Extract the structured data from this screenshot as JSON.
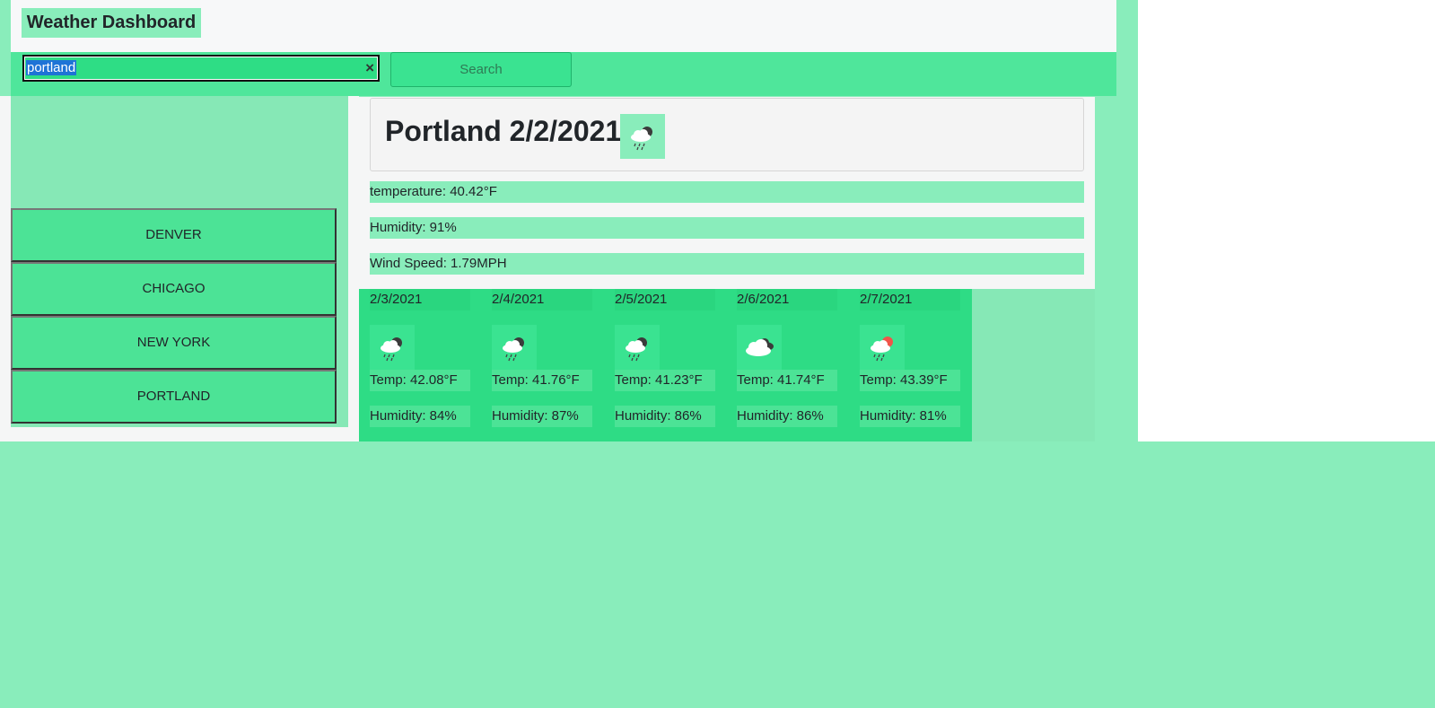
{
  "header": {
    "title": "Weather Dashboard"
  },
  "search": {
    "value": "portland",
    "clear_glyph": "×",
    "button_label": "Search"
  },
  "history": [
    "DENVER",
    "CHICAGO",
    "NEW YORK",
    "PORTLAND"
  ],
  "current": {
    "heading": "Portland 2/2/2021",
    "icon": "rain-cloud-icon",
    "temperature": "temperature: 40.42°F",
    "humidity": "Humidity: 91%",
    "wind": "Wind Speed: 1.79MPH"
  },
  "forecast": [
    {
      "date": "2/3/2021",
      "icon": "rain-cloud-icon",
      "temp": "Temp: 42.08°F",
      "humidity": "Humidity: 84%"
    },
    {
      "date": "2/4/2021",
      "icon": "rain-cloud-icon",
      "temp": "Temp: 41.76°F",
      "humidity": "Humidity: 87%"
    },
    {
      "date": "2/5/2021",
      "icon": "rain-cloud-icon",
      "temp": "Temp: 41.23°F",
      "humidity": "Humidity: 86%"
    },
    {
      "date": "2/6/2021",
      "icon": "cloudy-icon",
      "temp": "Temp: 41.74°F",
      "humidity": "Humidity: 86%"
    },
    {
      "date": "2/7/2021",
      "icon": "rain-sun-icon",
      "temp": "Temp: 43.39°F",
      "humidity": "Humidity: 81%"
    }
  ],
  "colors": {
    "accent": "#2edd85",
    "background": "#89edbb",
    "selection": "#1e73d6"
  }
}
